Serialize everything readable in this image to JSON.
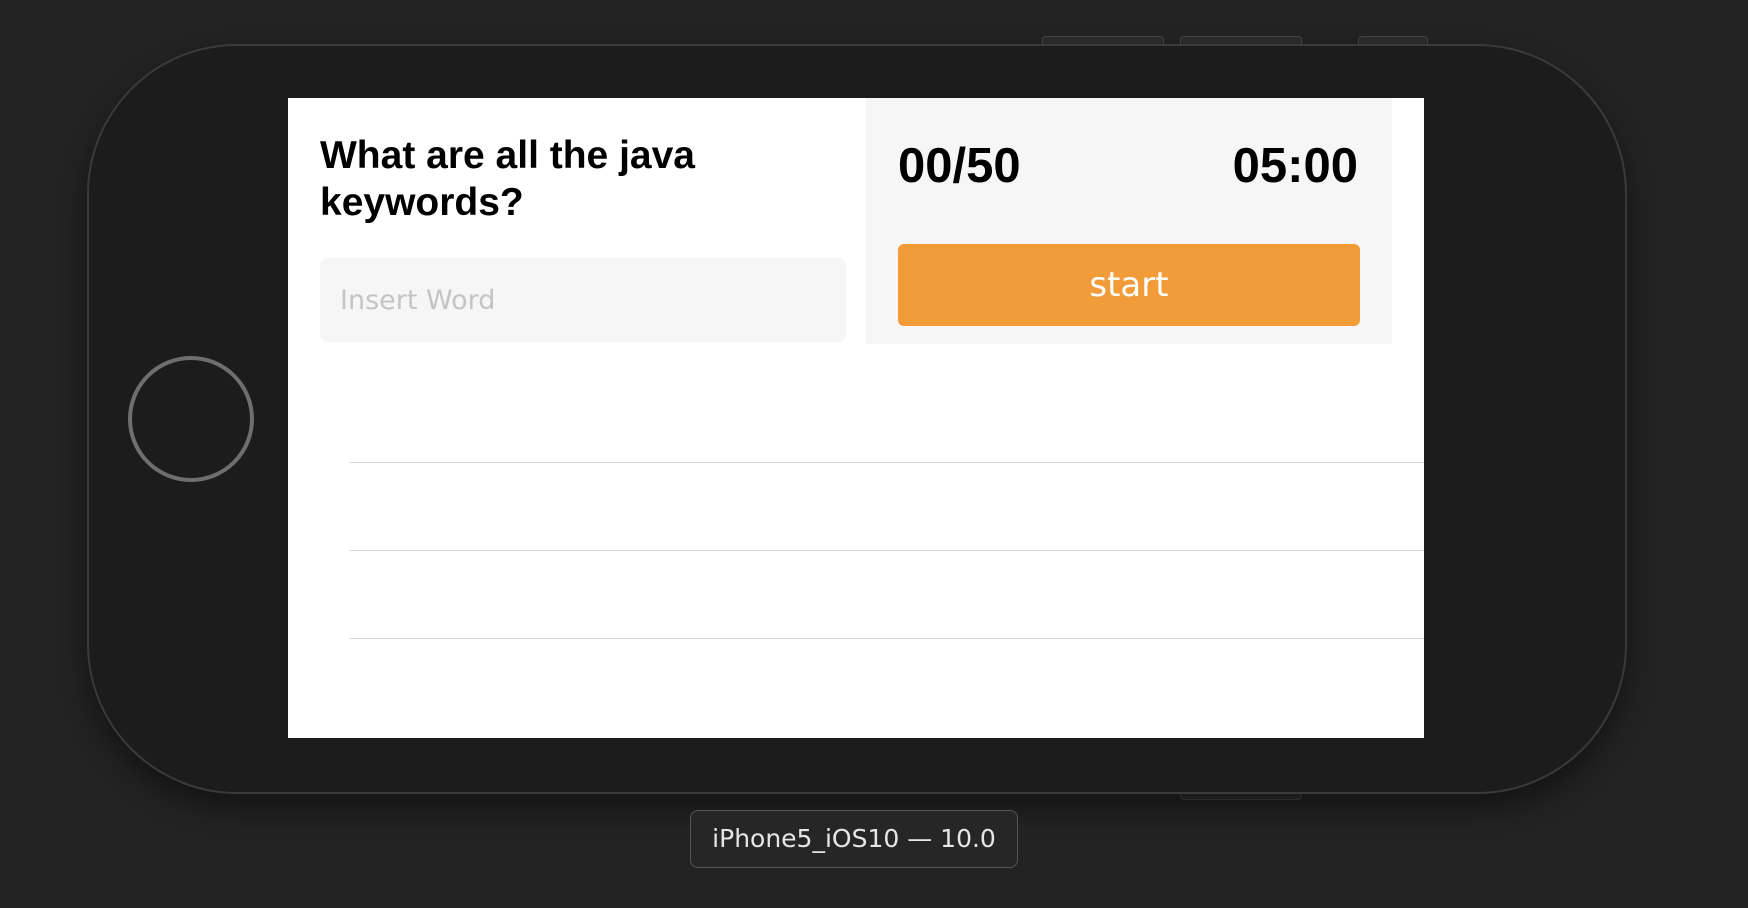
{
  "quiz": {
    "question": "What are all the java keywords?",
    "input_placeholder": "Insert Word",
    "input_value": "",
    "score": "00/50",
    "timer": "05:00",
    "start_label": "start",
    "answers": [
      "",
      "",
      ""
    ]
  },
  "simulator": {
    "device_label": "iPhone5_iOS10 — 10.0"
  },
  "colors": {
    "accent": "#f19b39",
    "panel_background": "#f6f6f6",
    "background": "#232323"
  }
}
